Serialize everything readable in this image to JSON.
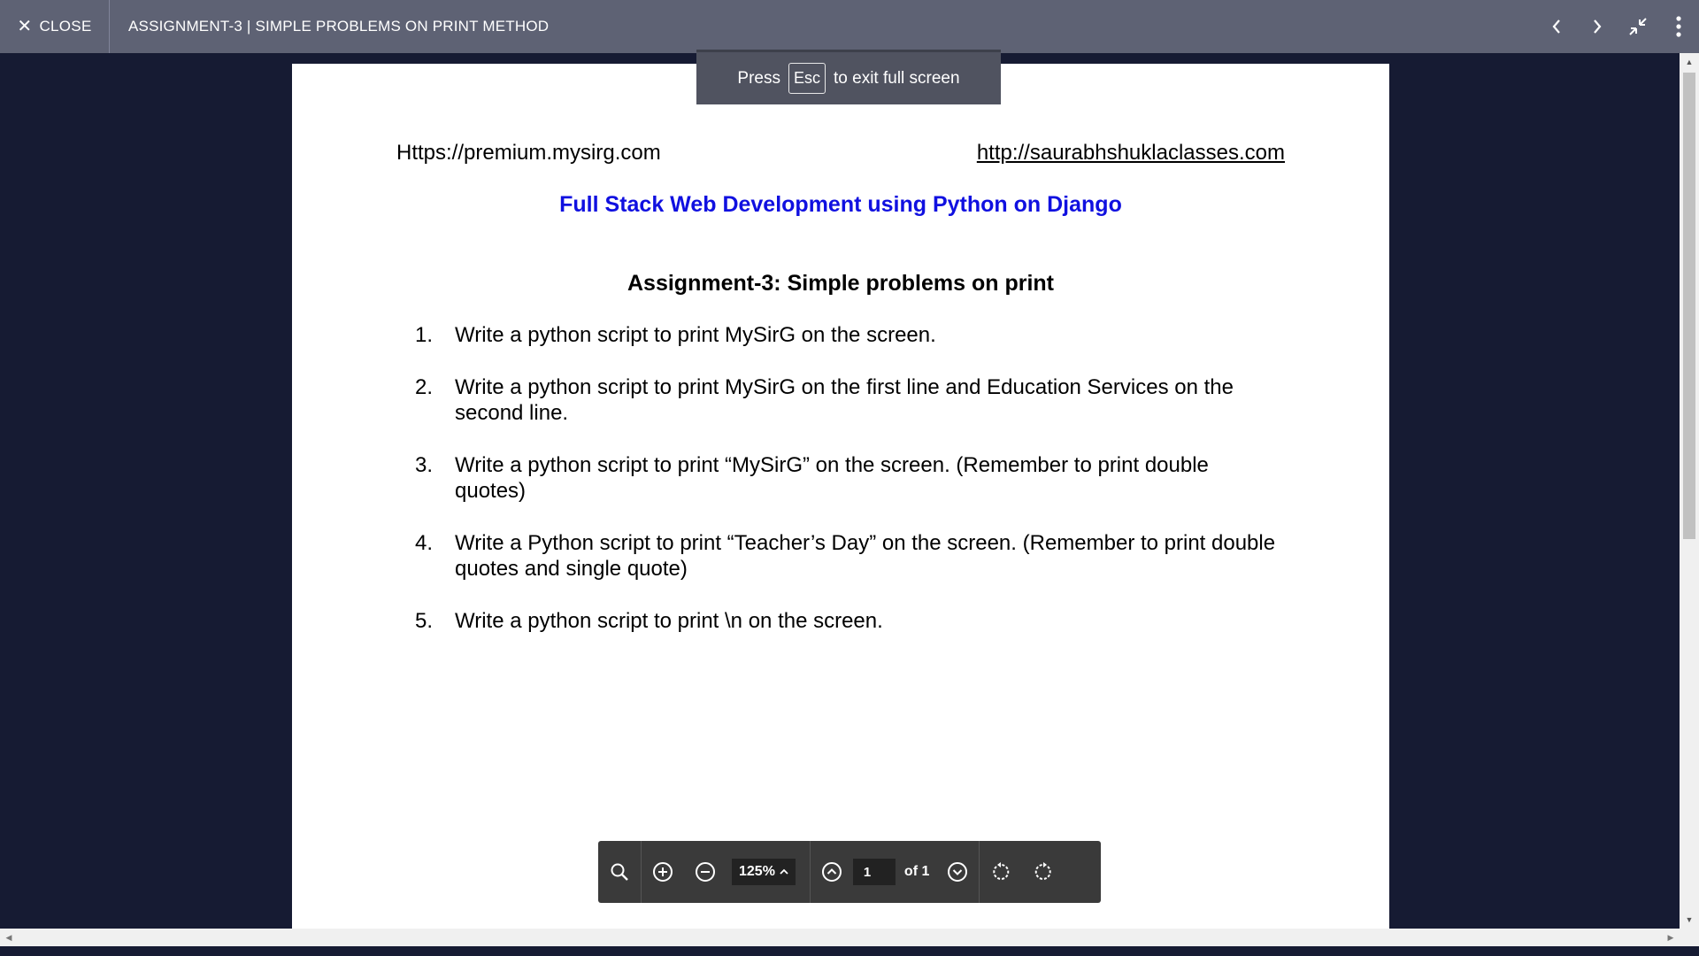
{
  "topbar": {
    "close_label": "CLOSE",
    "doc_title": "ASSIGNMENT-3 | SIMPLE PROBLEMS ON PRINT METHOD",
    "icons": [
      "prev-icon",
      "next-icon",
      "exit-fullscreen-icon",
      "more-icon"
    ]
  },
  "toast": {
    "press": "Press",
    "key": "Esc",
    "rest": "to exit full screen"
  },
  "document": {
    "header_left": "Https://premium.mysirg.com",
    "header_right": "http://saurabhshuklaclasses.com",
    "course_title": "Full Stack Web Development using Python on Django",
    "assignment_title": "Assignment-3: Simple problems on print",
    "questions": [
      {
        "num": "1.",
        "text": "Write a python script to print MySirG on the screen."
      },
      {
        "num": "2.",
        "text": "Write a python script to print MySirG on the first line and Education Services on the second line."
      },
      {
        "num": "3.",
        "text": "Write a python script to print “MySirG” on the screen. (Remember to print double quotes)"
      },
      {
        "num": "4.",
        "text": "Write a Python script to print “Teacher’s Day” on the screen. (Remember to print double quotes and single quote)"
      },
      {
        "num": "5.",
        "text": "Write a python script to print \\n on the screen."
      }
    ],
    "colors": {
      "course_title": "#1010e0"
    }
  },
  "pdf_toolbar": {
    "zoom": "125%",
    "page_value": "1",
    "page_total": "of 1"
  }
}
